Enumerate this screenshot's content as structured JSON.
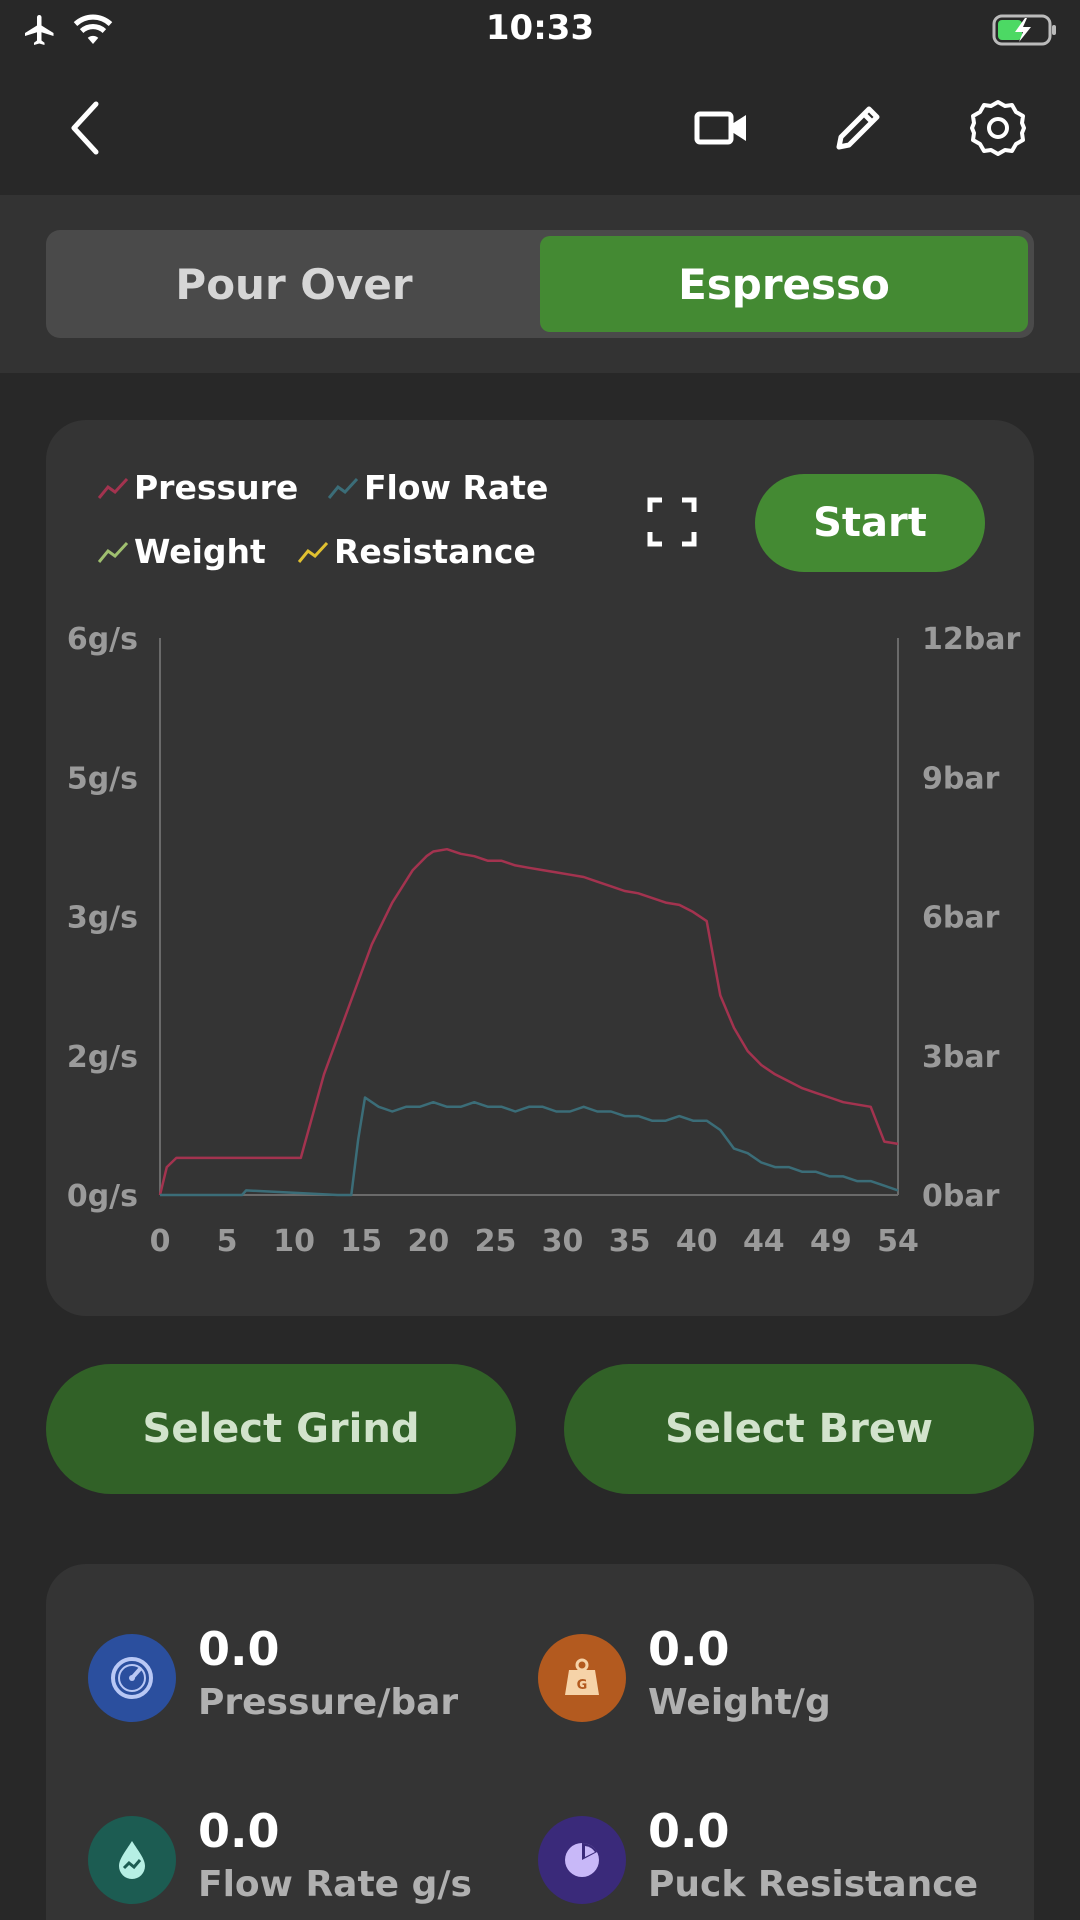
{
  "status_bar": {
    "time": "10:33"
  },
  "mode_tabs": [
    {
      "label": "Pour Over",
      "selected": false
    },
    {
      "label": "Espresso",
      "selected": true
    }
  ],
  "legend": [
    {
      "label": "Pressure",
      "color": "#a3334f"
    },
    {
      "label": "Flow Rate",
      "color": "#3b6d78"
    },
    {
      "label": "Weight",
      "color": "#9fbf6f"
    },
    {
      "label": "Resistance",
      "color": "#e0c030"
    }
  ],
  "start_label": "Start",
  "actions": {
    "select_grind": "Select Grind",
    "select_brew": "Select Brew"
  },
  "metrics": [
    {
      "value": "0.0",
      "label": "Pressure/bar",
      "color": "#2b4f9e"
    },
    {
      "value": "0.0",
      "label": "Weight/g",
      "color": "#b35a1f"
    },
    {
      "value": "0.0",
      "label": "Flow Rate g/s",
      "color": "#1c5c52"
    },
    {
      "value": "0.0",
      "label": "Puck Resistance",
      "color": "#3a2a7a"
    }
  ],
  "chart_data": {
    "type": "line",
    "xlabel": "",
    "x_ticks": [
      "0",
      "5",
      "10",
      "15",
      "20",
      "25",
      "30",
      "35",
      "40",
      "44",
      "49",
      "54"
    ],
    "xlim": [
      0,
      54
    ],
    "y_left_ticks": [
      "0g/s",
      "2g/s",
      "3g/s",
      "5g/s",
      "6g/s"
    ],
    "y_right_ticks": [
      "0bar",
      "3bar",
      "6bar",
      "9bar",
      "12bar"
    ],
    "ylim_right": [
      0,
      12
    ],
    "ylim_left": [
      0,
      6
    ],
    "grid": false,
    "series": [
      {
        "name": "Pressure",
        "axis": "right",
        "x": [
          0,
          0.5,
          1.2,
          2,
          10,
          10.3,
          12,
          14,
          15.5,
          17,
          18.5,
          19.5,
          20,
          21,
          22,
          23,
          24,
          25,
          26,
          27,
          28,
          29,
          30,
          31,
          32,
          33,
          34,
          35,
          36,
          37,
          38,
          39,
          40,
          41,
          42,
          43,
          44,
          45,
          46,
          47,
          48,
          49,
          50,
          52,
          53,
          54
        ],
        "y": [
          0,
          0.6,
          0.8,
          0.8,
          0.8,
          0.8,
          2.6,
          4.2,
          5.4,
          6.3,
          7.0,
          7.3,
          7.4,
          7.45,
          7.35,
          7.3,
          7.2,
          7.2,
          7.1,
          7.05,
          7.0,
          6.95,
          6.9,
          6.85,
          6.75,
          6.65,
          6.55,
          6.5,
          6.4,
          6.3,
          6.25,
          6.1,
          5.9,
          4.3,
          3.6,
          3.1,
          2.8,
          2.6,
          2.45,
          2.3,
          2.2,
          2.1,
          2.0,
          1.9,
          1.15,
          1.1
        ]
      },
      {
        "name": "Flow Rate",
        "axis": "left",
        "x": [
          0,
          6,
          6.3,
          13,
          14,
          14.5,
          15,
          16,
          17,
          18,
          19,
          20,
          21,
          22,
          23,
          24,
          25,
          26,
          27,
          28,
          29,
          30,
          31,
          32,
          33,
          34,
          35,
          36,
          37,
          38,
          39,
          40,
          41,
          42,
          43,
          44,
          45,
          46,
          47,
          48,
          49,
          50,
          51,
          52,
          53,
          54
        ],
        "y": [
          0,
          0,
          0.05,
          0,
          0,
          0.6,
          1.05,
          0.95,
          0.9,
          0.95,
          0.95,
          1.0,
          0.95,
          0.95,
          1.0,
          0.95,
          0.95,
          0.9,
          0.95,
          0.95,
          0.9,
          0.9,
          0.95,
          0.9,
          0.9,
          0.85,
          0.85,
          0.8,
          0.8,
          0.85,
          0.8,
          0.8,
          0.7,
          0.5,
          0.45,
          0.35,
          0.3,
          0.3,
          0.25,
          0.25,
          0.2,
          0.2,
          0.15,
          0.15,
          0.1,
          0.05
        ]
      }
    ]
  }
}
